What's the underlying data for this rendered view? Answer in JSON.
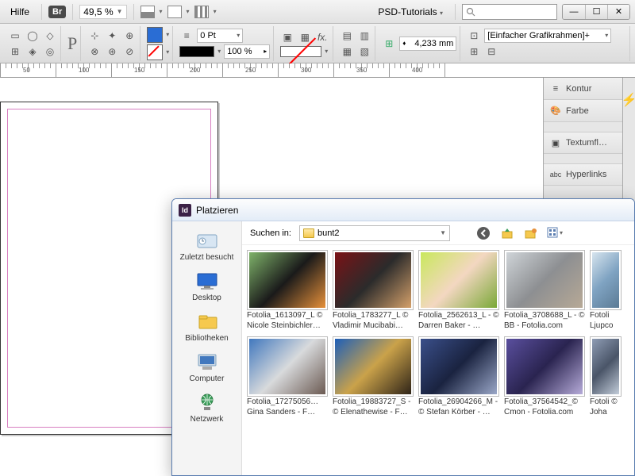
{
  "menubar": {
    "help": "Hilfe",
    "br": "Br",
    "zoom": "49,5 %",
    "workspace": "PSD-Tutorials"
  },
  "toolbar": {
    "stroke_pt": "0 Pt",
    "opacity": "100 %",
    "dim": "4,233 mm",
    "frame_type": "[Einfacher Grafikrahmen]+"
  },
  "ruler": {
    "marks": [
      "50",
      "100",
      "150",
      "200",
      "250",
      "300",
      "350",
      "400"
    ]
  },
  "panels": {
    "a": "Kontur",
    "b": "Farbe",
    "c": "Textumfl…",
    "d": "Hyperlinks"
  },
  "dialog": {
    "title": "Platzieren",
    "search_label": "Suchen in:",
    "folder": "bunt2",
    "places": {
      "recent": "Zuletzt besucht",
      "desktop": "Desktop",
      "libs": "Bibliotheken",
      "computer": "Computer",
      "network": "Netzwerk"
    },
    "files": [
      {
        "name": "Fotolia_1613097_L © Nicole Steinbichler…",
        "g": [
          "#7fb36a",
          "#1a1a1a",
          "#e6903a"
        ]
      },
      {
        "name": "Fotolia_1783277_L © Vladimir Mucibabi…",
        "g": [
          "#7a1216",
          "#2b2b2b",
          "#d4a06a"
        ]
      },
      {
        "name": "Fotolia_2562613_L - © Darren Baker - …",
        "g": [
          "#c9e85c",
          "#f3d7c1",
          "#7aa837"
        ]
      },
      {
        "name": "Fotolia_3708688_L - © BB - Fotolia.com",
        "g": [
          "#cfd4d8",
          "#8d8f92",
          "#b7a996"
        ]
      },
      {
        "name": "Fotoli Ljupco",
        "g": [
          "#d7e4ee",
          "#7fa3c2",
          "#5b7a94"
        ],
        "partial": true
      },
      {
        "name": "Fotolia_17275056… Gina Sanders - F…",
        "g": [
          "#4178be",
          "#d8dadc",
          "#6b5a52"
        ]
      },
      {
        "name": "Fotolia_19883727_S - © Elenathewise - F…",
        "g": [
          "#1e5fb8",
          "#caa24a",
          "#2f2418"
        ]
      },
      {
        "name": "Fotolia_26904266_M - © Stefan Körber - …",
        "g": [
          "#3a4f8a",
          "#1a2340",
          "#9aa7c8"
        ]
      },
      {
        "name": "Fotolia_37564542_© Cmon - Fotolia.com",
        "g": [
          "#5a4f9e",
          "#2a2450",
          "#b6abd9"
        ]
      },
      {
        "name": "Fotoli © Joha",
        "g": [
          "#8e9cb4",
          "#4a5568",
          "#c2ccd9"
        ],
        "partial": true
      }
    ]
  }
}
